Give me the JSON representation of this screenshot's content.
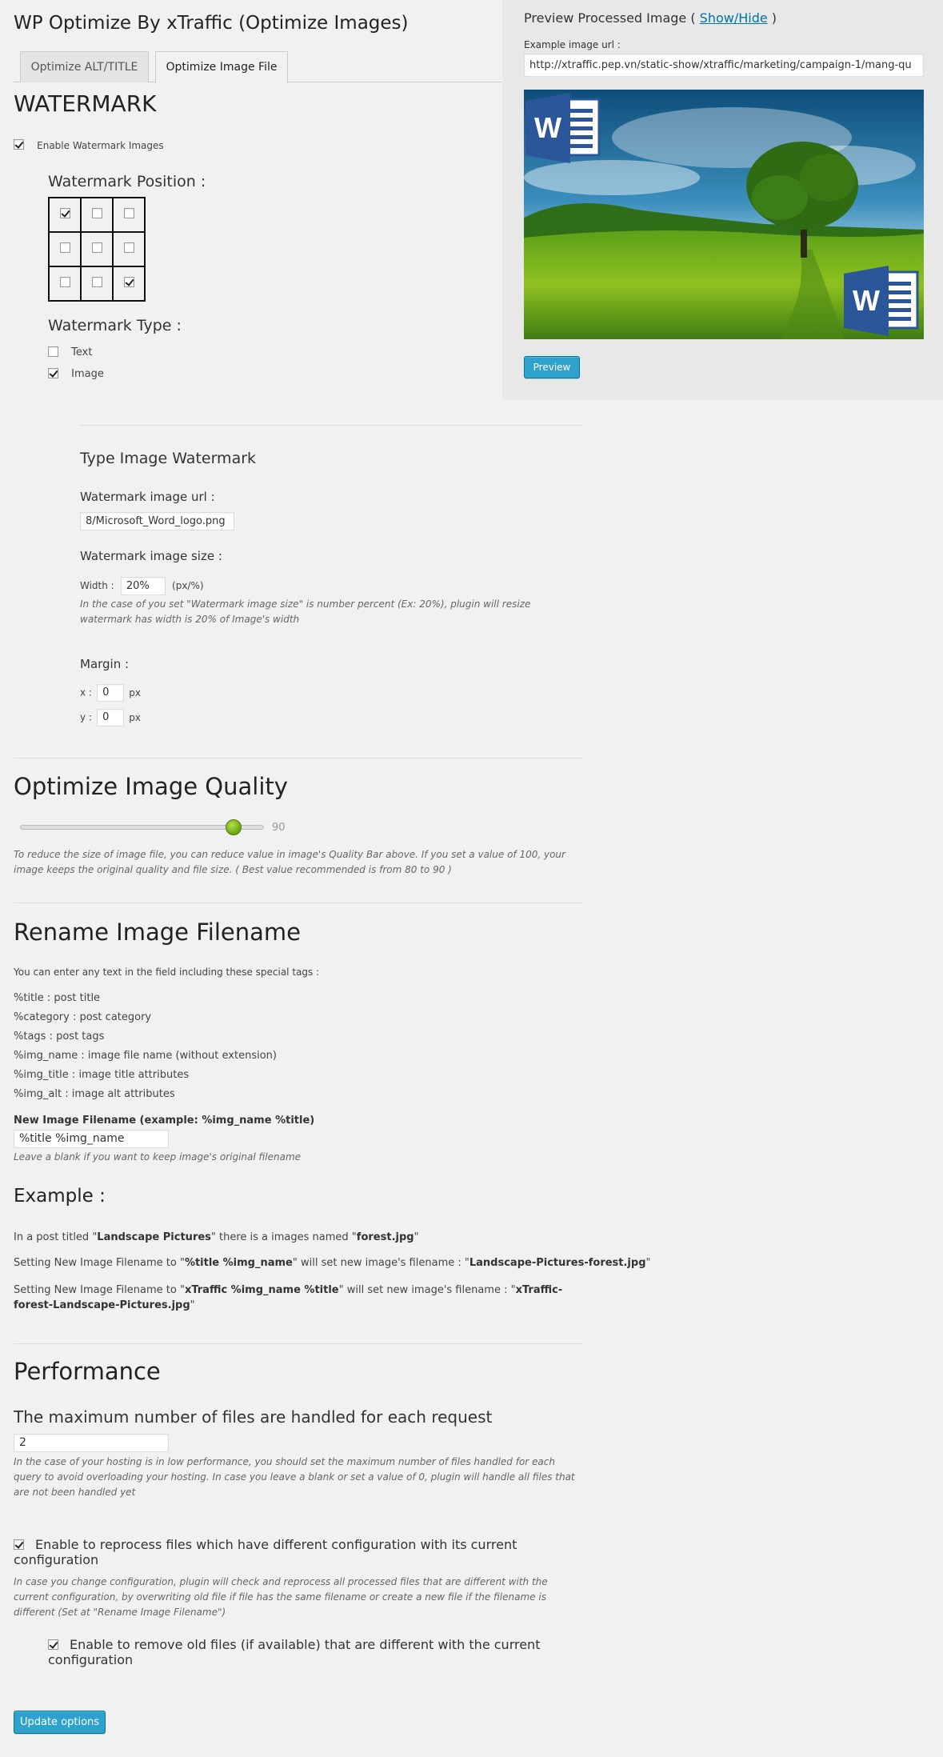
{
  "page": {
    "title": "WP Optimize By xTraffic (Optimize Images)",
    "tabs": [
      {
        "label": "Optimize ALT/TITLE",
        "active": false
      },
      {
        "label": "Optimize Image File",
        "active": true
      }
    ]
  },
  "preview": {
    "title_prefix": "Preview Processed Image ( ",
    "toggle_link": "Show/Hide",
    "title_suffix": " )",
    "url_label": "Example image url :",
    "url_value": "http://xtraffic.pep.vn/static-show/xtraffic/marketing/campaign-1/mang-qu",
    "button": "Preview"
  },
  "watermark": {
    "heading": "WATERMARK",
    "enable_label": "Enable Watermark Images",
    "enable_checked": true,
    "position_label": "Watermark Position :",
    "position_grid": [
      [
        true,
        false,
        false
      ],
      [
        false,
        false,
        false
      ],
      [
        false,
        false,
        true
      ]
    ],
    "type_label": "Watermark Type :",
    "types": [
      {
        "label": "Text",
        "checked": false
      },
      {
        "label": "Image",
        "checked": true
      }
    ],
    "image_section_title": "Type Image Watermark",
    "url_label": "Watermark image url :",
    "url_value": "8/Microsoft_Word_logo.png",
    "size_label": "Watermark image size :",
    "width_label": "Width :",
    "width_value": "20%",
    "width_unit": "(px/%)",
    "size_hint": "In the case of you set \"Watermark image size\" is number percent (Ex: 20%), plugin will resize watermark has width is 20% of Image's width",
    "margin_label": "Margin :",
    "margin_x_label": "x :",
    "margin_x_value": "0",
    "margin_y_label": "y :",
    "margin_y_value": "0",
    "px_unit": "px"
  },
  "quality": {
    "heading": "Optimize Image Quality",
    "value": 90,
    "value_label": "90",
    "max": 100,
    "hint": "To reduce the size of image file, you can reduce value in image's Quality Bar above. If you set a value of 100, your image keeps the original quality and file size. ( Best value recommended is from 80 to 90 )"
  },
  "rename": {
    "heading": "Rename Image Filename",
    "intro": "You can enter any text in the field including these special tags :",
    "tags": [
      {
        "tag": "%title",
        "desc": " : post title"
      },
      {
        "tag": "%category",
        "desc": " : post category"
      },
      {
        "tag": "%tags",
        "desc": " : post tags"
      },
      {
        "tag": "%img_name",
        "desc": " : image file name (without extension)"
      },
      {
        "tag": "%img_title",
        "desc": " : image title attributes"
      },
      {
        "tag": "%img_alt",
        "desc": " : image alt attributes"
      }
    ],
    "field_label": "New Image Filename (example: %img_name %title)",
    "field_value": "%title %img_name",
    "field_hint": "Leave a blank if you want to keep image's original filename",
    "example_heading": "Example :",
    "ex1_a": "In a post titled \"",
    "ex1_b": "Landscape Pictures",
    "ex1_c": "\" there is a images named \"",
    "ex1_d": "forest.jpg",
    "ex1_e": "\"",
    "ex2_a": "Setting New Image Filename to \"",
    "ex2_b": "%title %img_name",
    "ex2_c": "\" will set new image's filename : \"",
    "ex2_d": "Landscape-Pictures-forest.jpg",
    "ex2_e": "\"",
    "ex3_a": "Setting New Image Filename to \"",
    "ex3_b": "xTraffic %img_name %title",
    "ex3_c": "\" will set new image's filename : \"",
    "ex3_d": "xTraffic-forest-Landscape-Pictures.jpg",
    "ex3_e": "\""
  },
  "performance": {
    "heading": "Performance",
    "max_files_label": "The maximum number of files are handled for each request",
    "max_files_value": "2",
    "max_files_hint": "In the case of your hosting is in low performance, you should set the maximum number of files handled for each query to avoid overloading your hosting. In case you leave a blank or set a value of 0, plugin will handle all files that are not been handled yet",
    "reprocess_label": "Enable to reprocess files which have different configuration with its current configuration",
    "reprocess_checked": true,
    "reprocess_hint": "In case you change configuration, plugin will check and reprocess all processed files that are different with the current configuration, by overwriting old file if file has the same filename or create a new file if the filename is different (Set at \"Rename Image Filename\")",
    "remove_label": "Enable to remove old files (if available) that are different with the current configuration",
    "remove_checked": true
  },
  "footer": {
    "update_button": "Update options"
  },
  "colors": {
    "link": "#0074a2",
    "button": "#2ea2cc",
    "slider_handle": "#7ab317",
    "word_blue": "#2b579a"
  }
}
